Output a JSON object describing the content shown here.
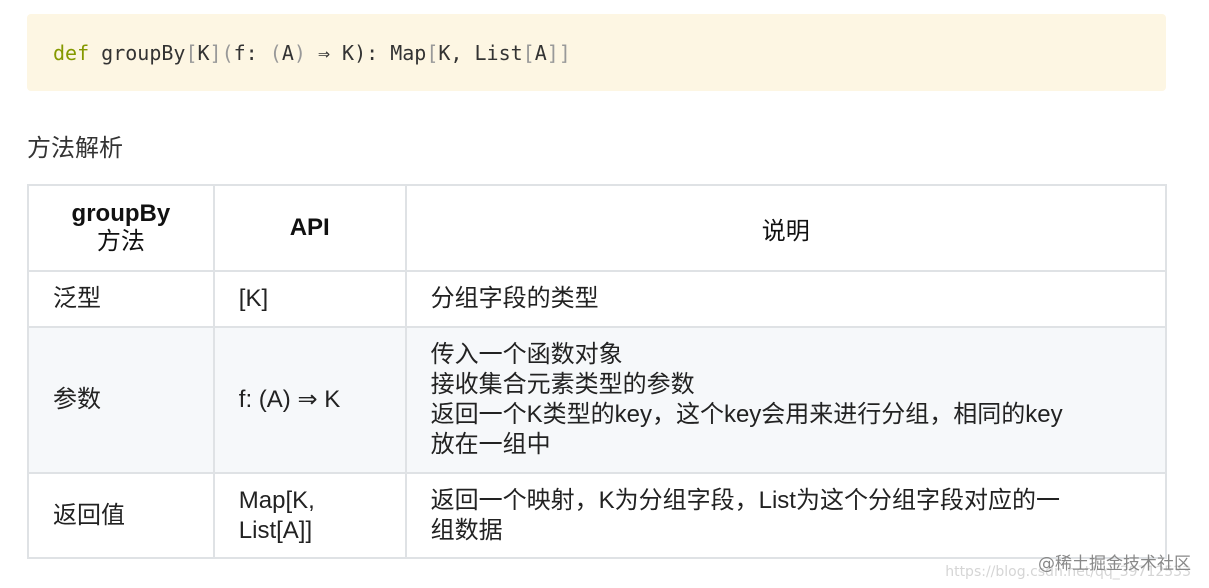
{
  "code": {
    "keyword": "def",
    "name": " groupBy",
    "open1": "[",
    "tparam": "K",
    "close1": "]",
    "open2": "(",
    "arg": "f: ",
    "open3": "(",
    "atype": "A",
    "close3": ")",
    "arrow": " ⇒ K): Map",
    "open4": "[",
    "ret1": "K, List",
    "open5": "[",
    "ret2": "A",
    "close5": "]]"
  },
  "section_title": "方法解析",
  "table": {
    "headers": {
      "col1_main": "groupBy",
      "col1_sub": "方法",
      "col2": "API",
      "col3": "说明"
    },
    "rows": [
      {
        "method": "泛型",
        "api": "[K]",
        "desc": [
          "分组字段的类型"
        ]
      },
      {
        "method": "参数",
        "api": "f: (A) ⇒ K",
        "desc": [
          "传入一个函数对象",
          "接收集合元素类型的参数",
          "返回一个K类型的key，这个key会用来进行分组，相同的key",
          "放在一组中"
        ]
      },
      {
        "method": "返回值",
        "api_lines": [
          "Map[K,",
          "List[A]]"
        ],
        "desc": [
          "返回一个映射，K为分组字段，List为这个分组字段对应的一",
          "组数据"
        ]
      }
    ]
  },
  "watermark": {
    "brand": "@稀土掘金技术社区",
    "url": "https://blog.csdn.net/qq_39712533"
  }
}
